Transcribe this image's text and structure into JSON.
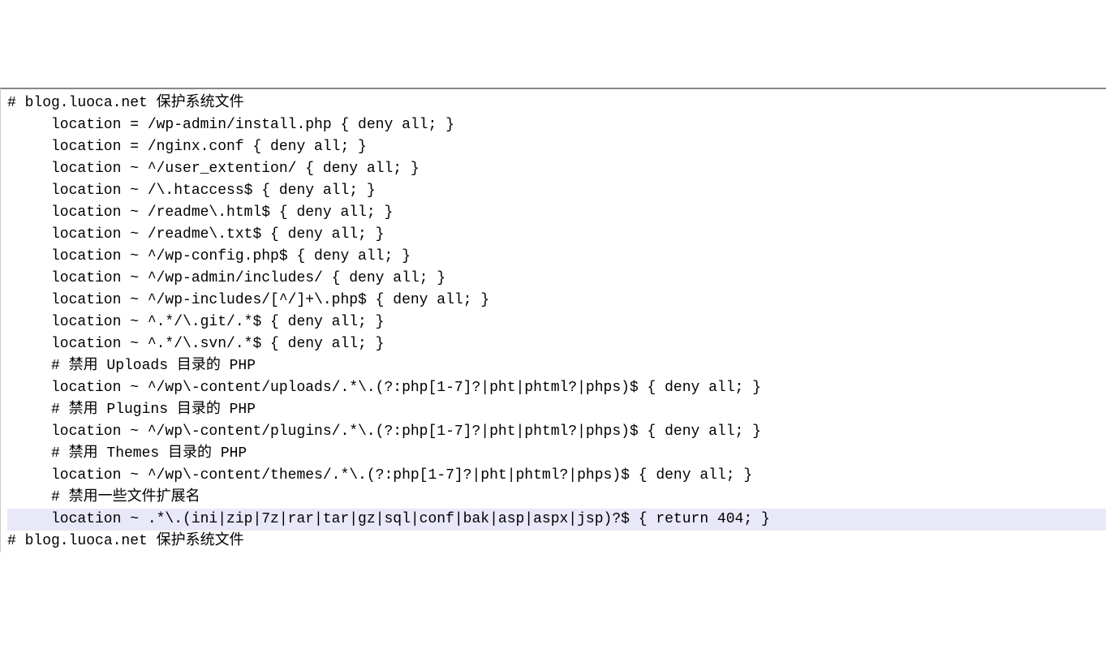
{
  "lines": [
    {
      "text": "# blog.luoca.net 保护系统文件",
      "indent": 0,
      "highlighted": false
    },
    {
      "text": "location = /wp-admin/install.php { deny all; }",
      "indent": 1,
      "highlighted": false
    },
    {
      "text": "location = /nginx.conf { deny all; }",
      "indent": 1,
      "highlighted": false
    },
    {
      "text": "location ~ ^/user_extention/ { deny all; }",
      "indent": 1,
      "highlighted": false
    },
    {
      "text": "location ~ /\\.htaccess$ { deny all; }",
      "indent": 1,
      "highlighted": false
    },
    {
      "text": "location ~ /readme\\.html$ { deny all; }",
      "indent": 1,
      "highlighted": false
    },
    {
      "text": "location ~ /readme\\.txt$ { deny all; }",
      "indent": 1,
      "highlighted": false
    },
    {
      "text": "location ~ ^/wp-config.php$ { deny all; }",
      "indent": 1,
      "highlighted": false
    },
    {
      "text": "location ~ ^/wp-admin/includes/ { deny all; }",
      "indent": 1,
      "highlighted": false
    },
    {
      "text": "location ~ ^/wp-includes/[^/]+\\.php$ { deny all; }",
      "indent": 1,
      "highlighted": false
    },
    {
      "text": "location ~ ^.*/\\.git/.*$ { deny all; }",
      "indent": 1,
      "highlighted": false
    },
    {
      "text": "location ~ ^.*/\\.svn/.*$ { deny all; }",
      "indent": 1,
      "highlighted": false
    },
    {
      "text": "# 禁用 Uploads 目录的 PHP",
      "indent": 1,
      "highlighted": false
    },
    {
      "text": "location ~ ^/wp\\-content/uploads/.*\\.(?:php[1-7]?|pht|phtml?|phps)$ { deny all; }",
      "indent": 1,
      "highlighted": false
    },
    {
      "text": "# 禁用 Plugins 目录的 PHP",
      "indent": 1,
      "highlighted": false
    },
    {
      "text": "location ~ ^/wp\\-content/plugins/.*\\.(?:php[1-7]?|pht|phtml?|phps)$ { deny all; }",
      "indent": 1,
      "highlighted": false
    },
    {
      "text": "# 禁用 Themes 目录的 PHP",
      "indent": 1,
      "highlighted": false
    },
    {
      "text": "location ~ ^/wp\\-content/themes/.*\\.(?:php[1-7]?|pht|phtml?|phps)$ { deny all; }",
      "indent": 1,
      "highlighted": false
    },
    {
      "text": "# 禁用一些文件扩展名",
      "indent": 1,
      "highlighted": false
    },
    {
      "text": "location ~ .*\\.(ini|zip|7z|rar|tar|gz|sql|conf|bak|asp|aspx|jsp)?$ { return 404; }",
      "indent": 1,
      "highlighted": true
    },
    {
      "text": "# blog.luoca.net 保护系统文件",
      "indent": 0,
      "highlighted": false
    }
  ]
}
